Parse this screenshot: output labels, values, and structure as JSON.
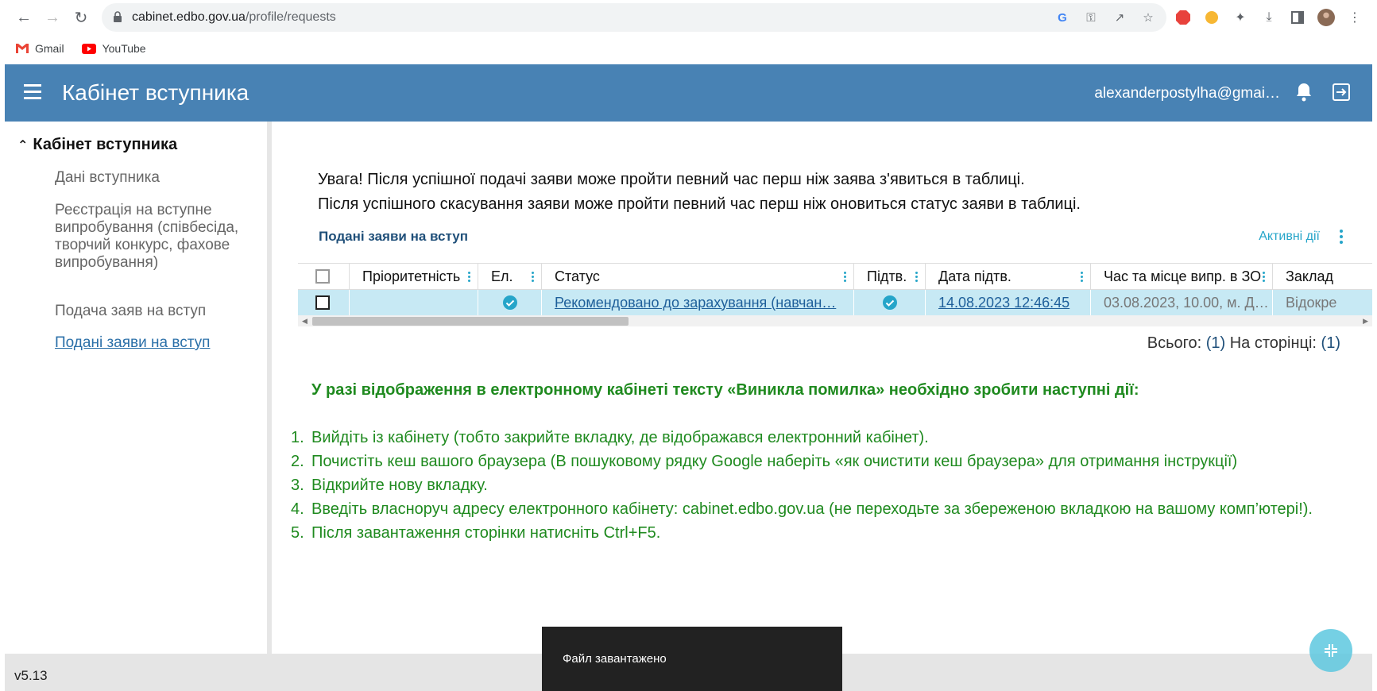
{
  "browser": {
    "url_host": "cabinet.edbo.gov.ua",
    "url_path": "/profile/requests",
    "bookmarks": [
      {
        "label": "Gmail"
      },
      {
        "label": "YouTube"
      }
    ]
  },
  "header": {
    "title": "Кабінет вступника",
    "user_email": "alexanderpostylha@gmai…"
  },
  "sidebar": {
    "heading": "Кабінет вступника",
    "items": [
      {
        "label": "Дані вступника"
      },
      {
        "label": "Реєстрація на вступне випробування (співбесіда, творчий конкурс, фахове випробування)"
      },
      {
        "label": "Подача заяв на вступ"
      },
      {
        "label": "Подані заяви на вступ"
      }
    ]
  },
  "main": {
    "notice_line1": "Увага! Після успішної подачі заяви може пройти певний час перш ніж заява з'явиться в таблиці.",
    "notice_line2": "Після успішного скасування заяви може пройти певний час перш ніж оновиться статус заяви в таблиці.",
    "section_title": "Подані заяви на вступ",
    "active_actions": "Активні дії",
    "columns": {
      "priority": "Пріоритетність",
      "el": "Ел.",
      "status": "Статус",
      "confirmed": "Підтв.",
      "confirm_date": "Дата підтв.",
      "exam": "Час та місце випр. в ЗО",
      "institution": "Заклад"
    },
    "row": {
      "priority": "",
      "status": "Рекомендовано до зарахування (навчан…",
      "confirm_date": "14.08.2023 12:46:45",
      "exam": "03.08.2023, 10.00, м. Д…",
      "institution": "Відокре"
    },
    "pager": {
      "total_label": "Всього:",
      "total": "(1)",
      "page_label": "На сторінці:",
      "page": "(1)"
    },
    "warning_title": "У разі відображення в електронному кабінеті тексту «Виникла помилка» необхідно зробити наступні дії:",
    "warning_steps": [
      {
        "num": "1.",
        "text": "Вийдіть із кабінету (тобто закрийте вкладку, де відображався електронний кабінет)."
      },
      {
        "num": "2.",
        "text": "Почистіть кеш вашого браузера (В пошуковому рядку Google наберіть «як очистити кеш браузера» для отримання інструкції)"
      },
      {
        "num": "3.",
        "text": "Відкрийте нову вкладку."
      },
      {
        "num": "4.",
        "text": "Введіть власноруч адресу електронного кабінету: cabinet.edbo.gov.ua (не переходьте за збереженою вкладкою на вашому комп’ютері!)."
      },
      {
        "num": "5.",
        "text": "Після завантаження сторінки натисніть Ctrl+F5."
      }
    ]
  },
  "footer": {
    "version": "v5.13"
  },
  "toast": {
    "message": "Файл завантажено"
  },
  "colors": {
    "header_bg": "#4882b4",
    "row_highlight": "#c7e9f4",
    "warning_green": "#1f8a1f",
    "accent_cyan": "#26a5c9"
  }
}
